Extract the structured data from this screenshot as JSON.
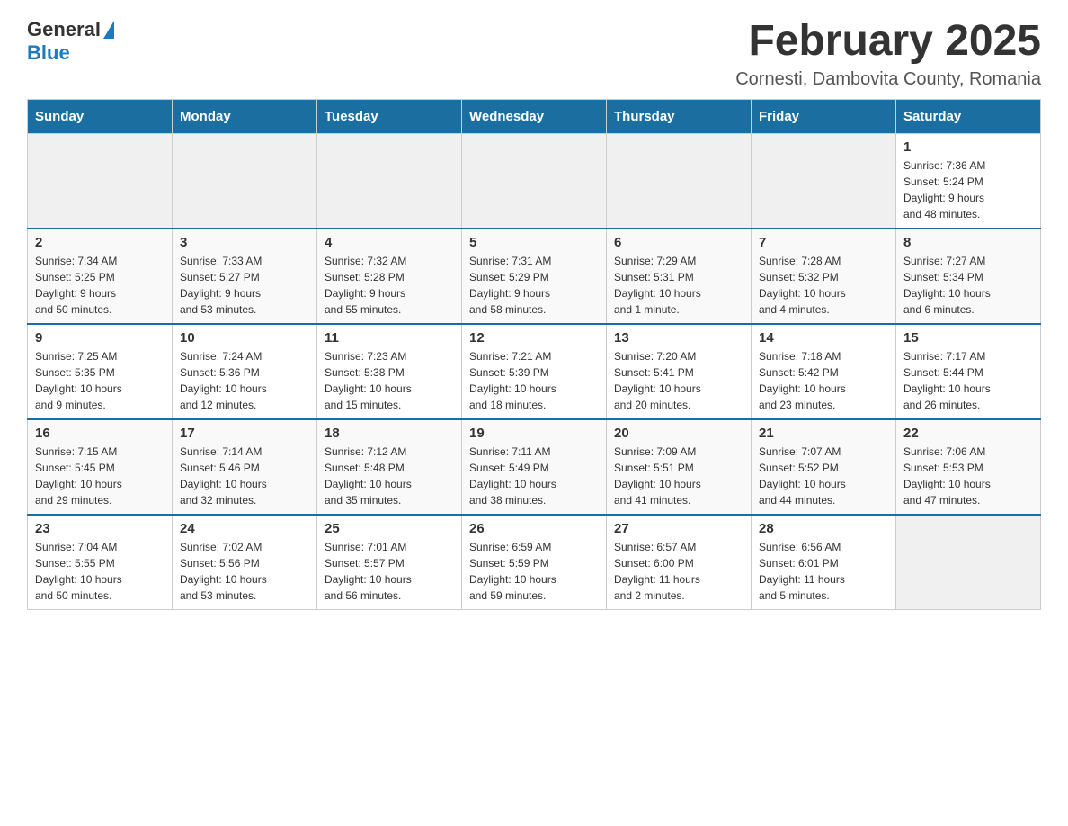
{
  "header": {
    "logo_general": "General",
    "logo_blue": "Blue",
    "title": "February 2025",
    "subtitle": "Cornesti, Dambovita County, Romania"
  },
  "days_of_week": [
    "Sunday",
    "Monday",
    "Tuesday",
    "Wednesday",
    "Thursday",
    "Friday",
    "Saturday"
  ],
  "weeks": [
    [
      {
        "day": "",
        "info": ""
      },
      {
        "day": "",
        "info": ""
      },
      {
        "day": "",
        "info": ""
      },
      {
        "day": "",
        "info": ""
      },
      {
        "day": "",
        "info": ""
      },
      {
        "day": "",
        "info": ""
      },
      {
        "day": "1",
        "info": "Sunrise: 7:36 AM\nSunset: 5:24 PM\nDaylight: 9 hours\nand 48 minutes."
      }
    ],
    [
      {
        "day": "2",
        "info": "Sunrise: 7:34 AM\nSunset: 5:25 PM\nDaylight: 9 hours\nand 50 minutes."
      },
      {
        "day": "3",
        "info": "Sunrise: 7:33 AM\nSunset: 5:27 PM\nDaylight: 9 hours\nand 53 minutes."
      },
      {
        "day": "4",
        "info": "Sunrise: 7:32 AM\nSunset: 5:28 PM\nDaylight: 9 hours\nand 55 minutes."
      },
      {
        "day": "5",
        "info": "Sunrise: 7:31 AM\nSunset: 5:29 PM\nDaylight: 9 hours\nand 58 minutes."
      },
      {
        "day": "6",
        "info": "Sunrise: 7:29 AM\nSunset: 5:31 PM\nDaylight: 10 hours\nand 1 minute."
      },
      {
        "day": "7",
        "info": "Sunrise: 7:28 AM\nSunset: 5:32 PM\nDaylight: 10 hours\nand 4 minutes."
      },
      {
        "day": "8",
        "info": "Sunrise: 7:27 AM\nSunset: 5:34 PM\nDaylight: 10 hours\nand 6 minutes."
      }
    ],
    [
      {
        "day": "9",
        "info": "Sunrise: 7:25 AM\nSunset: 5:35 PM\nDaylight: 10 hours\nand 9 minutes."
      },
      {
        "day": "10",
        "info": "Sunrise: 7:24 AM\nSunset: 5:36 PM\nDaylight: 10 hours\nand 12 minutes."
      },
      {
        "day": "11",
        "info": "Sunrise: 7:23 AM\nSunset: 5:38 PM\nDaylight: 10 hours\nand 15 minutes."
      },
      {
        "day": "12",
        "info": "Sunrise: 7:21 AM\nSunset: 5:39 PM\nDaylight: 10 hours\nand 18 minutes."
      },
      {
        "day": "13",
        "info": "Sunrise: 7:20 AM\nSunset: 5:41 PM\nDaylight: 10 hours\nand 20 minutes."
      },
      {
        "day": "14",
        "info": "Sunrise: 7:18 AM\nSunset: 5:42 PM\nDaylight: 10 hours\nand 23 minutes."
      },
      {
        "day": "15",
        "info": "Sunrise: 7:17 AM\nSunset: 5:44 PM\nDaylight: 10 hours\nand 26 minutes."
      }
    ],
    [
      {
        "day": "16",
        "info": "Sunrise: 7:15 AM\nSunset: 5:45 PM\nDaylight: 10 hours\nand 29 minutes."
      },
      {
        "day": "17",
        "info": "Sunrise: 7:14 AM\nSunset: 5:46 PM\nDaylight: 10 hours\nand 32 minutes."
      },
      {
        "day": "18",
        "info": "Sunrise: 7:12 AM\nSunset: 5:48 PM\nDaylight: 10 hours\nand 35 minutes."
      },
      {
        "day": "19",
        "info": "Sunrise: 7:11 AM\nSunset: 5:49 PM\nDaylight: 10 hours\nand 38 minutes."
      },
      {
        "day": "20",
        "info": "Sunrise: 7:09 AM\nSunset: 5:51 PM\nDaylight: 10 hours\nand 41 minutes."
      },
      {
        "day": "21",
        "info": "Sunrise: 7:07 AM\nSunset: 5:52 PM\nDaylight: 10 hours\nand 44 minutes."
      },
      {
        "day": "22",
        "info": "Sunrise: 7:06 AM\nSunset: 5:53 PM\nDaylight: 10 hours\nand 47 minutes."
      }
    ],
    [
      {
        "day": "23",
        "info": "Sunrise: 7:04 AM\nSunset: 5:55 PM\nDaylight: 10 hours\nand 50 minutes."
      },
      {
        "day": "24",
        "info": "Sunrise: 7:02 AM\nSunset: 5:56 PM\nDaylight: 10 hours\nand 53 minutes."
      },
      {
        "day": "25",
        "info": "Sunrise: 7:01 AM\nSunset: 5:57 PM\nDaylight: 10 hours\nand 56 minutes."
      },
      {
        "day": "26",
        "info": "Sunrise: 6:59 AM\nSunset: 5:59 PM\nDaylight: 10 hours\nand 59 minutes."
      },
      {
        "day": "27",
        "info": "Sunrise: 6:57 AM\nSunset: 6:00 PM\nDaylight: 11 hours\nand 2 minutes."
      },
      {
        "day": "28",
        "info": "Sunrise: 6:56 AM\nSunset: 6:01 PM\nDaylight: 11 hours\nand 5 minutes."
      },
      {
        "day": "",
        "info": ""
      }
    ]
  ]
}
